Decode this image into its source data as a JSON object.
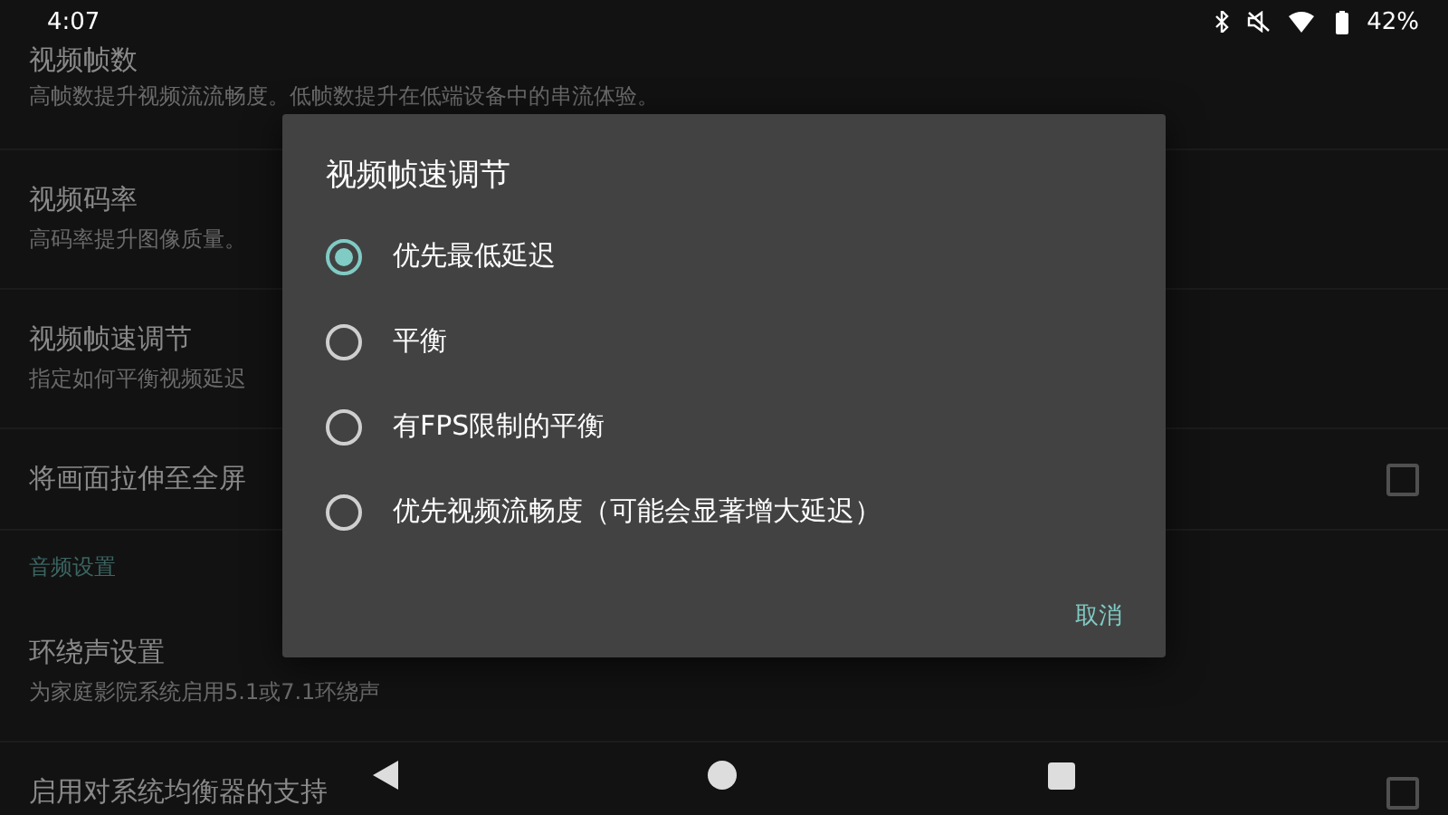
{
  "status_bar": {
    "time": "4:07",
    "battery": "42%"
  },
  "settings": [
    {
      "kind": "item",
      "title": "视频帧数",
      "summary": "高帧数提升视频流流畅度。低帧数提升在低端设备中的串流体验。"
    },
    {
      "kind": "item",
      "title": "视频码率",
      "summary": "高码率提升图像质量。"
    },
    {
      "kind": "item",
      "title": "视频帧速调节",
      "summary": "指定如何平衡视频延迟"
    },
    {
      "kind": "checkbox",
      "title": "将画面拉伸至全屏",
      "checked": false
    },
    {
      "kind": "category",
      "title": "音频设置"
    },
    {
      "kind": "item",
      "title": "环绕声设置",
      "summary": "为家庭影院系统启用5.1或7.1环绕声"
    },
    {
      "kind": "checkbox",
      "title": "启用对系统均衡器的支持",
      "checked": false
    }
  ],
  "dialog": {
    "title": "视频帧速调节",
    "options": [
      {
        "label": "优先最低延迟",
        "selected": true
      },
      {
        "label": "平衡",
        "selected": false
      },
      {
        "label": "有FPS限制的平衡",
        "selected": false
      },
      {
        "label": "优先视频流畅度（可能会显著增大延迟）",
        "selected": false
      }
    ],
    "button": "取消"
  }
}
